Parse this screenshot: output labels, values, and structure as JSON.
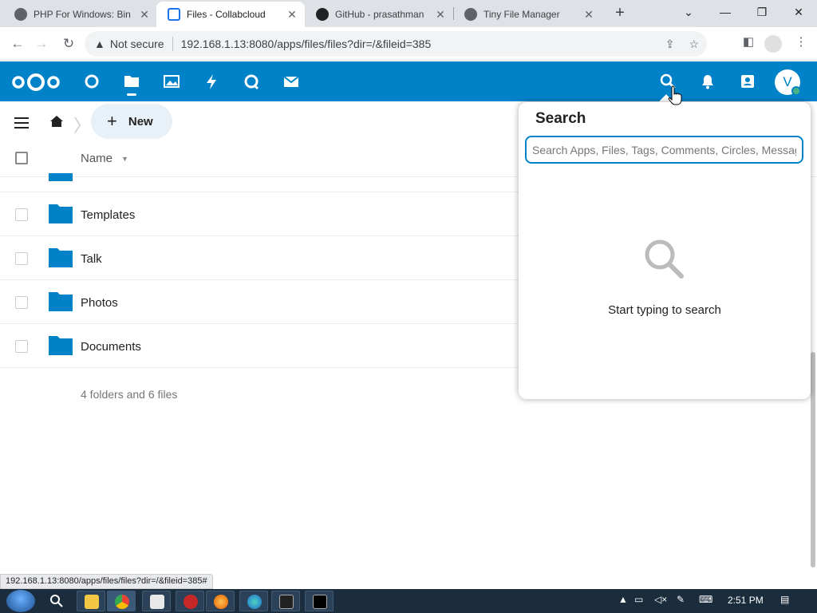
{
  "browser": {
    "tabs": [
      {
        "title": "PHP For Windows: Bin",
        "active": false
      },
      {
        "title": "Files - Collabcloud",
        "active": true
      },
      {
        "title": "GitHub - prasathman",
        "active": false
      },
      {
        "title": "Tiny File Manager",
        "active": false
      }
    ],
    "security_label": "Not secure",
    "url": "192.168.1.13:8080/apps/files/files?dir=/&fileid=385",
    "status_url": "192.168.1.13:8080/apps/files/files?dir=/&fileid=385#"
  },
  "app": {
    "header_color": "#0082c9",
    "new_label": "New",
    "column_name": "Name",
    "files": [
      {
        "name": "Templates",
        "type": "folder"
      },
      {
        "name": "Talk",
        "type": "folder"
      },
      {
        "name": "Photos",
        "type": "folder"
      },
      {
        "name": "Documents",
        "type": "folder"
      }
    ],
    "summary": "4 folders and 6 files",
    "avatar_initial": "V"
  },
  "search": {
    "title": "Search",
    "placeholder": "Search Apps, Files, Tags, Comments, Circles, Messages",
    "empty_text": "Start typing to search"
  },
  "taskbar": {
    "time": "2:51 PM"
  }
}
